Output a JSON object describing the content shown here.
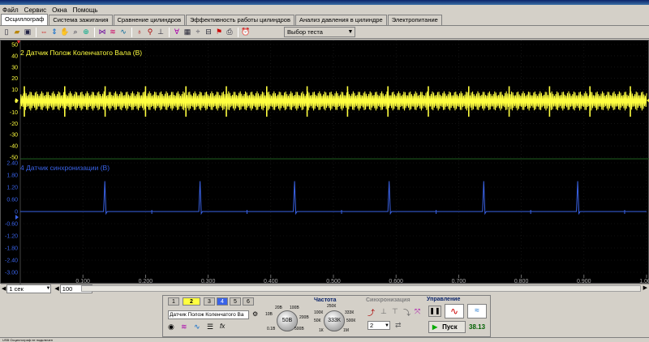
{
  "menu": [
    "Файл",
    "Сервис",
    "Окна",
    "Помощь"
  ],
  "tabs": [
    "Осциллограф",
    "Система зажигания",
    "Сравнение цилиндров",
    "Эффективность работы цилиндров",
    "Анализ давления в цилиндре",
    "Электропитание"
  ],
  "toolbar": {
    "test_select": "Выбор теста"
  },
  "channels": {
    "ch2": {
      "label": "2 Датчик Полож Коленчатого Вала (В)",
      "color": "#ffff40",
      "y_ticks": [
        "50",
        "40",
        "30",
        "20",
        "10",
        "0",
        "-10",
        "-20",
        "-30",
        "-40",
        "-50"
      ]
    },
    "ch4": {
      "label": "4 Датчик синхронизации (В)",
      "color": "#3a63e8",
      "y_ticks": [
        "2.40",
        "1.80",
        "1.20",
        "0.60",
        "0",
        "-0.60",
        "-1.20",
        "-1.80",
        "-2.40",
        "-3.00"
      ]
    }
  },
  "x_ticks": [
    "0.100",
    "0.200",
    "0.300",
    "0.400",
    "0.500",
    "0.600",
    "0.700",
    "0.800",
    "0.900",
    "1.000"
  ],
  "timebase": {
    "value": "1 сек",
    "points": "100"
  },
  "channel_buttons": [
    "1",
    "2",
    "3",
    "4",
    "5",
    "6"
  ],
  "channel_panel": {
    "selected_source": "Датчик Полож Коленчатого Ва",
    "range": "50В",
    "range_labels": [
      "10В",
      "20В",
      "100В",
      "200В",
      "0.1В",
      "500В"
    ]
  },
  "frequency": {
    "title": "Частота",
    "value": "333К",
    "labels": [
      "250К",
      "100К",
      "333К",
      "50К",
      "500К",
      "1К",
      "1М"
    ]
  },
  "sync": {
    "title": "Синхронизация",
    "channel": "2"
  },
  "control": {
    "title": "Управление",
    "start_label": "Пуск",
    "value": "38.13"
  },
  "status": "USB Осциллограф не подключен"
}
